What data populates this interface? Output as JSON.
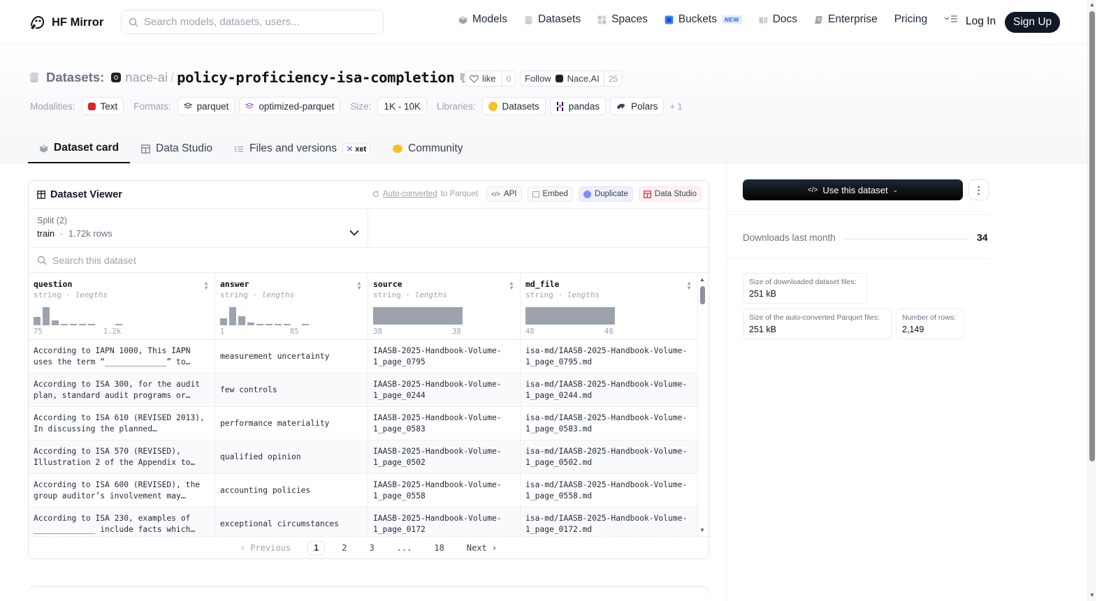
{
  "header": {
    "logo_text": "HF Mirror",
    "search_placeholder": "Search models, datasets, users...",
    "nav": [
      {
        "label": "Models",
        "icon": "cube-icon",
        "color": "#6b7280"
      },
      {
        "label": "Datasets",
        "icon": "database-icon",
        "color": "#9ca3af"
      },
      {
        "label": "Spaces",
        "icon": "grid-icon",
        "color": "#9ca3af"
      },
      {
        "label": "Buckets",
        "icon": "bucket-icon",
        "color": "#2563eb",
        "badge": "NEW"
      },
      {
        "label": "Docs",
        "icon": "book-icon",
        "color": "#9ca3af"
      },
      {
        "label": "Enterprise",
        "icon": "enterprise-icon",
        "color": "#6b7280"
      },
      {
        "label": "Pricing"
      }
    ],
    "login_label": "Log In",
    "signup_label": "Sign Up"
  },
  "repo": {
    "type_label": "Datasets:",
    "org": "nace-ai",
    "separator": "/",
    "name": "policy-proficiency-isa-completion",
    "like_label": "like",
    "like_count": "0",
    "follow_label": "Follow",
    "follow_org": "Nace.AI",
    "follow_count": "25"
  },
  "meta": {
    "modalities_label": "Modalities:",
    "modalities": [
      {
        "label": "Text",
        "color": "#dc2626"
      }
    ],
    "formats_label": "Formats:",
    "formats": [
      "parquet",
      "optimized-parquet"
    ],
    "size_label": "Size:",
    "size": "1K - 10K",
    "libraries_label": "Libraries:",
    "libraries": [
      "Datasets",
      "pandas",
      "Polars"
    ],
    "more": "+ 1"
  },
  "tabs": [
    {
      "label": "Dataset card",
      "active": true
    },
    {
      "label": "Data Studio"
    },
    {
      "label": "Files and versions",
      "badge": "xet"
    },
    {
      "label": "Community"
    }
  ],
  "viewer": {
    "title": "Dataset Viewer",
    "autoconv_link": "Auto-converted",
    "autoconv_rest": "to Parquet",
    "actions": [
      "API",
      "Embed",
      "Duplicate",
      "Data Studio"
    ],
    "split_label": "Split (2)",
    "split_name": "train",
    "split_dot": "·",
    "split_rows": "1.72k rows",
    "search_placeholder": "Search this dataset",
    "columns": [
      {
        "name": "question",
        "type": "string",
        "stat": "lengths",
        "min": "75",
        "max": "1.2k",
        "hist": [
          0.45,
          1.0,
          0.28,
          0.08,
          0.06,
          0.05,
          0.04,
          0.0,
          0.0,
          0.04
        ]
      },
      {
        "name": "answer",
        "type": "string",
        "stat": "lengths",
        "min": "1",
        "max": "85",
        "hist": [
          0.4,
          1.0,
          0.5,
          0.14,
          0.07,
          0.06,
          0.05,
          0.05,
          0.0,
          0.04
        ]
      },
      {
        "name": "source",
        "type": "string",
        "stat": "lengths",
        "min": "38",
        "max": "38",
        "hist": [
          1.0
        ]
      },
      {
        "name": "md_file",
        "type": "string",
        "stat": "lengths",
        "min": "48",
        "max": "48",
        "hist": [
          1.0
        ]
      }
    ],
    "type_sep": "·",
    "rows": [
      {
        "question": "According to IAPN 1000, This IAPN uses the term “_____________” to…",
        "answer": "measurement uncertainty",
        "source": "IAASB-2025-Handbook-Volume-1_page_0795",
        "md_file": "isa-md/IAASB-2025-Handbook-Volume-1_page_0795.md"
      },
      {
        "question": "According to ISA 300, for the audit plan, standard audit programs or…",
        "answer": "few controls",
        "source": "IAASB-2025-Handbook-Volume-1_page_0244",
        "md_file": "isa-md/IAASB-2025-Handbook-Volume-1_page_0244.md"
      },
      {
        "question": "According to ISA 610 (REVISED 2013), In discussing the planned…",
        "answer": "performance materiality",
        "source": "IAASB-2025-Handbook-Volume-1_page_0583",
        "md_file": "isa-md/IAASB-2025-Handbook-Volume-1_page_0583.md"
      },
      {
        "question": "According to ISA 570 (REVISED), Illustration 2 of the Appendix to…",
        "answer": "qualified opinion",
        "source": "IAASB-2025-Handbook-Volume-1_page_0502",
        "md_file": "isa-md/IAASB-2025-Handbook-Volume-1_page_0502.md"
      },
      {
        "question": "According to ISA 600 (REVISED), the group auditor’s involvement may…",
        "answer": "accounting policies",
        "source": "IAASB-2025-Handbook-Volume-1_page_0558",
        "md_file": "isa-md/IAASB-2025-Handbook-Volume-1_page_0558.md"
      },
      {
        "question": "According to ISA 230, examples of _____________ include facts which…",
        "answer": "exceptional circumstances",
        "source": "IAASB-2025-Handbook-Volume-1_page_0172",
        "md_file": "isa-md/IAASB-2025-Handbook-Volume-1_page_0172.md"
      }
    ],
    "pager": {
      "prev": "Previous",
      "pages": [
        "1",
        "2",
        "3",
        "...",
        "18"
      ],
      "current": "1",
      "next": "Next"
    }
  },
  "sidebar": {
    "use_label": "Use this dataset",
    "downloads_label": "Downloads last month",
    "downloads_value": "34",
    "stats": [
      {
        "label": "Size of downloaded dataset files:",
        "value": "251 kB"
      },
      {
        "label": "Size of the auto-converted Parquet files:",
        "value": "251 kB"
      },
      {
        "label": "Number of rows:",
        "value": "2,149"
      }
    ]
  }
}
